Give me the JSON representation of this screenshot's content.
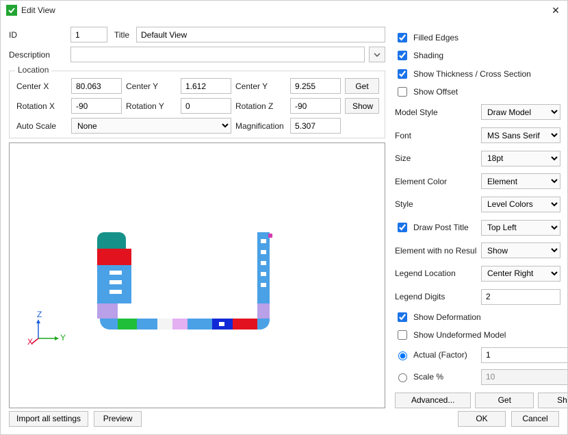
{
  "window": {
    "title": "Edit View"
  },
  "top": {
    "id_label": "ID",
    "id_value": "1",
    "title_label": "Title",
    "title_value": "Default View",
    "desc_label": "Description",
    "desc_value": ""
  },
  "location": {
    "legend": "Location",
    "centerx_label": "Center X",
    "centerx": "80.063",
    "centery_label": "Center Y",
    "centery": "1.612",
    "centerz_label": "Center Y",
    "centerz": "9.255",
    "get": "Get",
    "rotx_label": "Rotation X",
    "rotx": "-90",
    "roty_label": "Rotation Y",
    "roty": "0",
    "rotz_label": "Rotation Z",
    "rotz": "-90",
    "show": "Show",
    "autoscale_label": "Auto Scale",
    "autoscale": "None",
    "mag_label": "Magnification",
    "mag": "5.307"
  },
  "right": {
    "filled_edges": "Filled Edges",
    "shading": "Shading",
    "show_thickness": "Show Thickness / Cross Section",
    "show_offset": "Show Offset",
    "model_style_label": "Model Style",
    "model_style": "Draw Model",
    "font_label": "Font",
    "font": "MS Sans Serif",
    "size_label": "Size",
    "size": "18pt",
    "elem_color_label": "Element Color",
    "elem_color": "Element",
    "style_label": "Style",
    "style": "Level Colors",
    "draw_post_title": "Draw Post Title",
    "draw_post_title_val": "Top Left",
    "elem_no_result_label": "Element with no Resul",
    "elem_no_result": "Show",
    "legend_loc_label": "Legend Location",
    "legend_loc": "Center Right",
    "legend_digits_label": "Legend Digits",
    "legend_digits": "2",
    "show_deformation": "Show Deformation",
    "show_undeformed": "Show Undeformed Model",
    "actual_label": "Actual (Factor)",
    "actual_val": "1",
    "scale_label": "Scale %",
    "scale_val": "10",
    "advanced": "Advanced...",
    "get": "Get",
    "show": "Show"
  },
  "footer": {
    "import_all": "Import all settings",
    "preview": "Preview",
    "ok": "OK",
    "cancel": "Cancel"
  },
  "axis": {
    "z": "Z",
    "x": "X",
    "y": "Y"
  }
}
